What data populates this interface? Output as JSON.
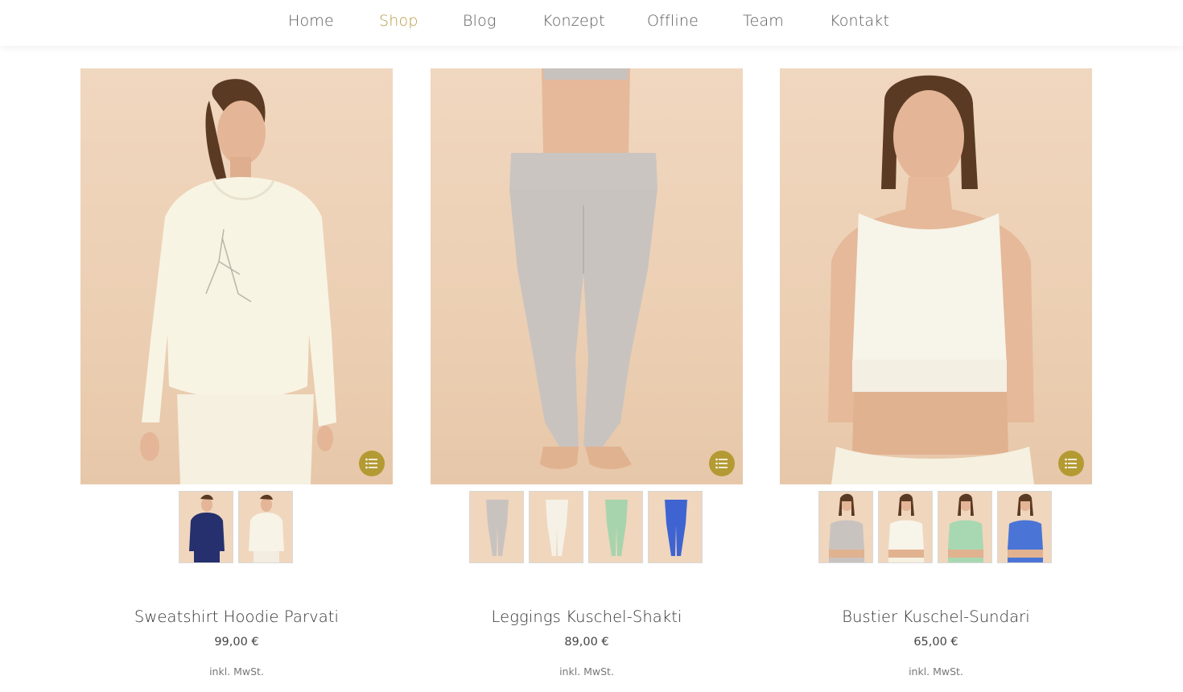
{
  "nav": {
    "items": [
      {
        "label": "Home",
        "active": false
      },
      {
        "label": "Shop",
        "active": true
      },
      {
        "label": "Blog",
        "active": false
      },
      {
        "label": "Konzept",
        "active": false
      },
      {
        "label": "Offline",
        "active": false
      },
      {
        "label": "Team",
        "active": false
      },
      {
        "label": "Kontakt",
        "active": false
      }
    ],
    "accent_color": "#b49a45"
  },
  "products": [
    {
      "title": "Sweatshirt Hoodie Parvati",
      "price": "99,00 €",
      "tax_note": "inkl. MwSt.",
      "variant_colors": [
        "#26306e",
        "#f7f3e6"
      ]
    },
    {
      "title": "Leggings Kuschel-Shakti",
      "price": "89,00 €",
      "tax_note": "inkl. MwSt.",
      "variant_colors": [
        "#c9c3c0",
        "#f5f1e6",
        "#a8d4ad",
        "#3f64d2"
      ]
    },
    {
      "title": "Bustier Kuschel-Sundari",
      "price": "65,00 €",
      "tax_note": "inkl. MwSt.",
      "variant_colors": [
        "#c9c3c0",
        "#f7f4ea",
        "#a8d8b2",
        "#4a74d6"
      ]
    }
  ],
  "colors": {
    "background": "#ffffff",
    "product_backdrop": "#eccfb3",
    "list_button": "#b49a33",
    "text": "#333333"
  },
  "icons": {
    "list_button": "list-icon"
  }
}
